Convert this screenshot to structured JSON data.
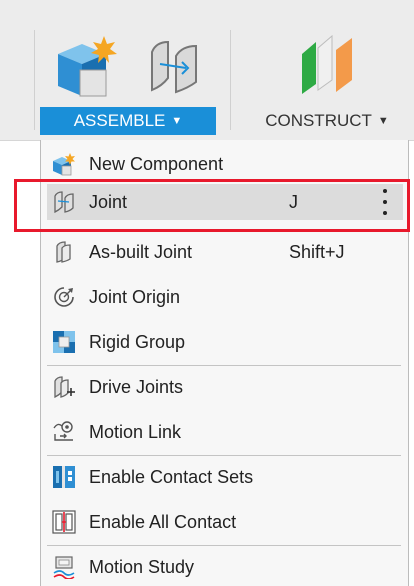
{
  "toolbar": {
    "assemble_label": "ASSEMBLE",
    "construct_label": "CONSTRUCT",
    "accent_color": "#1a8fd8"
  },
  "menu": {
    "items": [
      {
        "label": "New Component",
        "shortcut": "",
        "icon": "new-component-icon"
      },
      {
        "label": "Joint",
        "shortcut": "J",
        "icon": "joint-icon",
        "highlighted": true
      },
      {
        "label": "As-built Joint",
        "shortcut": "Shift+J",
        "icon": "as-built-joint-icon"
      },
      {
        "label": "Joint Origin",
        "shortcut": "",
        "icon": "joint-origin-icon"
      },
      {
        "label": "Rigid Group",
        "shortcut": "",
        "icon": "rigid-group-icon"
      },
      {
        "label": "Drive Joints",
        "shortcut": "",
        "icon": "drive-joints-icon"
      },
      {
        "label": "Motion Link",
        "shortcut": "",
        "icon": "motion-link-icon"
      },
      {
        "label": "Enable Contact Sets",
        "shortcut": "",
        "icon": "enable-contact-sets-icon"
      },
      {
        "label": "Enable All Contact",
        "shortcut": "",
        "icon": "enable-all-contact-icon"
      },
      {
        "label": "Motion Study",
        "shortcut": "",
        "icon": "motion-study-icon"
      }
    ]
  },
  "highlight_color": "#e8192c"
}
